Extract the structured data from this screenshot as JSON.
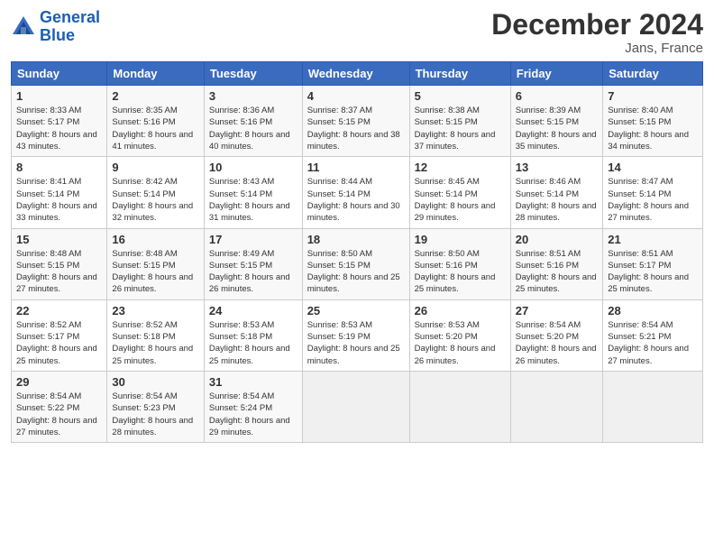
{
  "logo": {
    "line1": "General",
    "line2": "Blue"
  },
  "title": "December 2024",
  "location": "Jans, France",
  "days_header": [
    "Sunday",
    "Monday",
    "Tuesday",
    "Wednesday",
    "Thursday",
    "Friday",
    "Saturday"
  ],
  "weeks": [
    [
      {
        "num": "1",
        "sunrise": "8:33 AM",
        "sunset": "5:17 PM",
        "daylight": "8 hours and 43 minutes."
      },
      {
        "num": "2",
        "sunrise": "8:35 AM",
        "sunset": "5:16 PM",
        "daylight": "8 hours and 41 minutes."
      },
      {
        "num": "3",
        "sunrise": "8:36 AM",
        "sunset": "5:16 PM",
        "daylight": "8 hours and 40 minutes."
      },
      {
        "num": "4",
        "sunrise": "8:37 AM",
        "sunset": "5:15 PM",
        "daylight": "8 hours and 38 minutes."
      },
      {
        "num": "5",
        "sunrise": "8:38 AM",
        "sunset": "5:15 PM",
        "daylight": "8 hours and 37 minutes."
      },
      {
        "num": "6",
        "sunrise": "8:39 AM",
        "sunset": "5:15 PM",
        "daylight": "8 hours and 35 minutes."
      },
      {
        "num": "7",
        "sunrise": "8:40 AM",
        "sunset": "5:15 PM",
        "daylight": "8 hours and 34 minutes."
      }
    ],
    [
      {
        "num": "8",
        "sunrise": "8:41 AM",
        "sunset": "5:14 PM",
        "daylight": "8 hours and 33 minutes."
      },
      {
        "num": "9",
        "sunrise": "8:42 AM",
        "sunset": "5:14 PM",
        "daylight": "8 hours and 32 minutes."
      },
      {
        "num": "10",
        "sunrise": "8:43 AM",
        "sunset": "5:14 PM",
        "daylight": "8 hours and 31 minutes."
      },
      {
        "num": "11",
        "sunrise": "8:44 AM",
        "sunset": "5:14 PM",
        "daylight": "8 hours and 30 minutes."
      },
      {
        "num": "12",
        "sunrise": "8:45 AM",
        "sunset": "5:14 PM",
        "daylight": "8 hours and 29 minutes."
      },
      {
        "num": "13",
        "sunrise": "8:46 AM",
        "sunset": "5:14 PM",
        "daylight": "8 hours and 28 minutes."
      },
      {
        "num": "14",
        "sunrise": "8:47 AM",
        "sunset": "5:14 PM",
        "daylight": "8 hours and 27 minutes."
      }
    ],
    [
      {
        "num": "15",
        "sunrise": "8:48 AM",
        "sunset": "5:15 PM",
        "daylight": "8 hours and 27 minutes."
      },
      {
        "num": "16",
        "sunrise": "8:48 AM",
        "sunset": "5:15 PM",
        "daylight": "8 hours and 26 minutes."
      },
      {
        "num": "17",
        "sunrise": "8:49 AM",
        "sunset": "5:15 PM",
        "daylight": "8 hours and 26 minutes."
      },
      {
        "num": "18",
        "sunrise": "8:50 AM",
        "sunset": "5:15 PM",
        "daylight": "8 hours and 25 minutes."
      },
      {
        "num": "19",
        "sunrise": "8:50 AM",
        "sunset": "5:16 PM",
        "daylight": "8 hours and 25 minutes."
      },
      {
        "num": "20",
        "sunrise": "8:51 AM",
        "sunset": "5:16 PM",
        "daylight": "8 hours and 25 minutes."
      },
      {
        "num": "21",
        "sunrise": "8:51 AM",
        "sunset": "5:17 PM",
        "daylight": "8 hours and 25 minutes."
      }
    ],
    [
      {
        "num": "22",
        "sunrise": "8:52 AM",
        "sunset": "5:17 PM",
        "daylight": "8 hours and 25 minutes."
      },
      {
        "num": "23",
        "sunrise": "8:52 AM",
        "sunset": "5:18 PM",
        "daylight": "8 hours and 25 minutes."
      },
      {
        "num": "24",
        "sunrise": "8:53 AM",
        "sunset": "5:18 PM",
        "daylight": "8 hours and 25 minutes."
      },
      {
        "num": "25",
        "sunrise": "8:53 AM",
        "sunset": "5:19 PM",
        "daylight": "8 hours and 25 minutes."
      },
      {
        "num": "26",
        "sunrise": "8:53 AM",
        "sunset": "5:20 PM",
        "daylight": "8 hours and 26 minutes."
      },
      {
        "num": "27",
        "sunrise": "8:54 AM",
        "sunset": "5:20 PM",
        "daylight": "8 hours and 26 minutes."
      },
      {
        "num": "28",
        "sunrise": "8:54 AM",
        "sunset": "5:21 PM",
        "daylight": "8 hours and 27 minutes."
      }
    ],
    [
      {
        "num": "29",
        "sunrise": "8:54 AM",
        "sunset": "5:22 PM",
        "daylight": "8 hours and 27 minutes."
      },
      {
        "num": "30",
        "sunrise": "8:54 AM",
        "sunset": "5:23 PM",
        "daylight": "8 hours and 28 minutes."
      },
      {
        "num": "31",
        "sunrise": "8:54 AM",
        "sunset": "5:24 PM",
        "daylight": "8 hours and 29 minutes."
      },
      null,
      null,
      null,
      null
    ]
  ]
}
